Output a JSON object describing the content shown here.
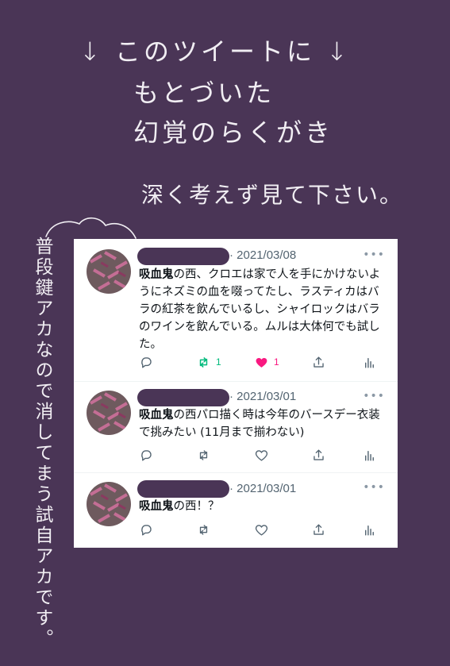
{
  "header": {
    "line1": "↓ このツイートに ↓",
    "line2": "もとづいた",
    "line3": "幻覚のらくがき",
    "line4": "深く考えず見て下さい。"
  },
  "side_note": "普段鍵アカなので消してまう試自アカです。",
  "tweets": [
    {
      "date": "· 2021/03/08",
      "more": "•••",
      "bold": "吸血鬼",
      "text": "の西、クロエは家で人を手にかけないようにネズミの血を啜ってたし、ラスティカはバラの紅茶を飲んでいるし、シャイロックはバラのワインを飲んでいる。ムルは大体何でも試した。",
      "retweets": "1",
      "likes": "1",
      "retweet_color": "#00ba7c",
      "like_color": "#f91880"
    },
    {
      "date": "· 2021/03/01",
      "more": "•••",
      "bold": "吸血鬼",
      "text": "の西パロ描く時は今年のバースデー衣装で挑みたい (11月まで揃わない)"
    },
    {
      "date": "· 2021/03/01",
      "more": "•••",
      "bold": "吸血鬼",
      "text": "の西！？"
    }
  ],
  "icons": [
    "reply-icon",
    "retweet-icon",
    "like-icon",
    "share-icon",
    "analytics-icon",
    "more-icon"
  ]
}
